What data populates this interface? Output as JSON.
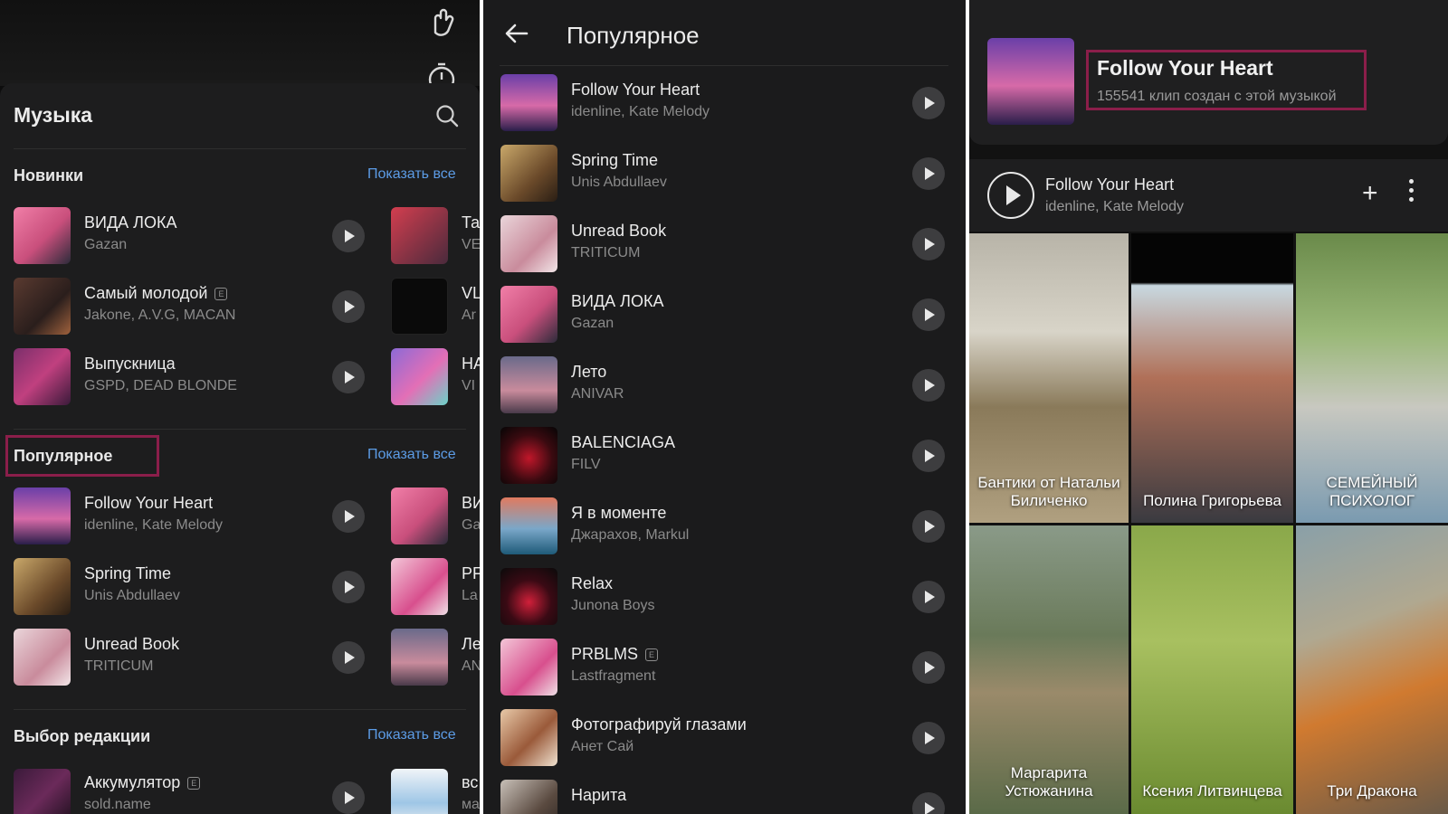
{
  "music_panel": {
    "title": "Музыка",
    "sections": [
      {
        "title": "Новинки",
        "show_all": "Показать все",
        "tracks": [
          {
            "title": "ВИДА ЛОКА",
            "artist": "Gazan",
            "explicit": false
          },
          {
            "title": "Самый молодой",
            "artist": "Jakone, A.V.G, MACAN",
            "explicit": true
          },
          {
            "title": "Выпускница",
            "artist": "GSPD, DEAD BLONDE",
            "explicit": false
          }
        ],
        "peek": [
          {
            "title": "Та",
            "artist": "VE"
          },
          {
            "title": "VL",
            "artist": "Ar"
          },
          {
            "title": "НА",
            "artist": "VI"
          }
        ]
      },
      {
        "title": "Популярное",
        "show_all": "Показать все",
        "tracks": [
          {
            "title": "Follow Your Heart",
            "artist": "idenline, Kate Melody",
            "explicit": false
          },
          {
            "title": "Spring Time",
            "artist": "Unis Abdullaev",
            "explicit": false
          },
          {
            "title": "Unread Book",
            "artist": "TRITICUM",
            "explicit": false
          }
        ],
        "peek": [
          {
            "title": "ВИ",
            "artist": "Ga"
          },
          {
            "title": "PF",
            "artist": "La"
          },
          {
            "title": "Ле",
            "artist": "AN"
          }
        ]
      },
      {
        "title": "Выбор редакции",
        "show_all": "Показать все",
        "tracks": [
          {
            "title": "Аккумулятор",
            "artist": "sold.name",
            "explicit": true
          }
        ],
        "peek": [
          {
            "title": "вс",
            "artist": "ма"
          }
        ]
      }
    ]
  },
  "popular_panel": {
    "title": "Популярное",
    "tracks": [
      {
        "title": "Follow Your Heart",
        "artist": "idenline, Kate Melody",
        "explicit": false
      },
      {
        "title": "Spring Time",
        "artist": "Unis Abdullaev",
        "explicit": false
      },
      {
        "title": "Unread Book",
        "artist": "TRITICUM",
        "explicit": false
      },
      {
        "title": "ВИДА ЛОКА",
        "artist": "Gazan",
        "explicit": false
      },
      {
        "title": "Лето",
        "artist": "ANIVAR",
        "explicit": false
      },
      {
        "title": "BALENCIAGA",
        "artist": "FILV",
        "explicit": false
      },
      {
        "title": "Я в моменте",
        "artist": "Джарахов, Markul",
        "explicit": false
      },
      {
        "title": "Relax",
        "artist": "Junona Boys",
        "explicit": false
      },
      {
        "title": "PRBLMS",
        "artist": "Lastfragment",
        "explicit": true
      },
      {
        "title": "Фотографируй глазами",
        "artist": "Анет Сай",
        "explicit": false
      },
      {
        "title": "Нарита",
        "artist": "",
        "explicit": false
      }
    ]
  },
  "track_panel": {
    "title": "Follow Your Heart",
    "clips_count": "155541 клип создан с этой музыкой",
    "player": {
      "title": "Follow Your Heart",
      "artist": "idenline, Kate Melody"
    },
    "clips": [
      {
        "label": "Бантики от Натальи Биличенко"
      },
      {
        "label": "Полина Григорьева"
      },
      {
        "label": "СЕМЕЙНЫЙ ПСИХОЛОГ"
      },
      {
        "label": "Маргарита Устюжанина"
      },
      {
        "label": "Ксения Литвинцева"
      },
      {
        "label": "Три Дракона"
      }
    ]
  },
  "colors": {
    "accent_link": "#5c9ce6",
    "highlight_box": "#8b1e4a"
  }
}
